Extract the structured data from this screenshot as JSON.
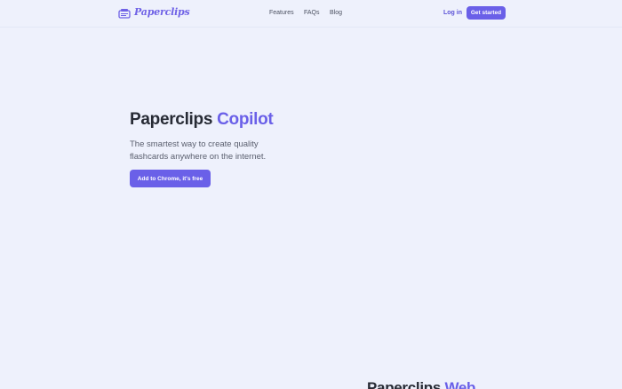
{
  "header": {
    "logo_text": "Paperclips",
    "logo_icon": "paperclips-logo-icon",
    "nav": [
      "Features",
      "FAQs",
      "Blog"
    ],
    "login_label": "Log in",
    "get_started_label": "Get started"
  },
  "hero": {
    "title_main": "Paperclips",
    "title_accent": "Copilot",
    "subtitle": "The smartest way to create quality flashcards anywhere on the internet.",
    "cta_label": "Add to Chrome, it's free"
  },
  "next_section": {
    "title_main": "Paperclips",
    "title_accent": "Web"
  },
  "colors": {
    "background": "#eef1fc",
    "accent": "#6a60e8",
    "heading": "#272b35",
    "body_text": "#5a5f6e"
  }
}
